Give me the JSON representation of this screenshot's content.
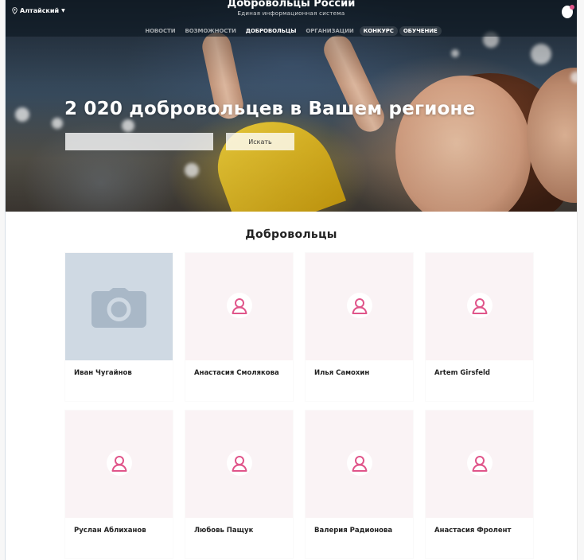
{
  "header": {
    "region": "Алтайский",
    "brand_title": "Добровольцы России",
    "brand_subtitle": "Единая информационная система",
    "nav": [
      {
        "label": "НОВОСТИ"
      },
      {
        "label": "ВОЗМОЖНОСТИ"
      },
      {
        "label": "ДОБРОВОЛЬЦЫ"
      },
      {
        "label": "ОРГАНИЗАЦИИ"
      },
      {
        "label": "КОНКУРС"
      },
      {
        "label": "ОБУЧЕНИЕ"
      }
    ]
  },
  "hero": {
    "title": "2 020 добровольцев в Вашем регионе",
    "search_placeholder": "",
    "search_button": "Искать"
  },
  "section": {
    "title": "Добровольцы"
  },
  "volunteers": [
    {
      "name": "Иван Чугайнов",
      "image": "camera-placeholder"
    },
    {
      "name": "Анастасия Смолякова",
      "image": "user-placeholder"
    },
    {
      "name": "Илья Самохин",
      "image": "user-placeholder"
    },
    {
      "name": "Artem Girsfeld",
      "image": "user-placeholder"
    },
    {
      "name": "Руслан Аблиханов",
      "image": "user-placeholder"
    },
    {
      "name": "Любовь Пащук",
      "image": "user-placeholder"
    },
    {
      "name": "Валерия Радионова",
      "image": "user-placeholder"
    },
    {
      "name": "Анастасия Фролент",
      "image": "user-placeholder"
    }
  ],
  "colors": {
    "accent_pink": "#e0558a",
    "card_media_bg": "#faf3f5",
    "photo_placeholder_bg": "#cfd9e3"
  }
}
